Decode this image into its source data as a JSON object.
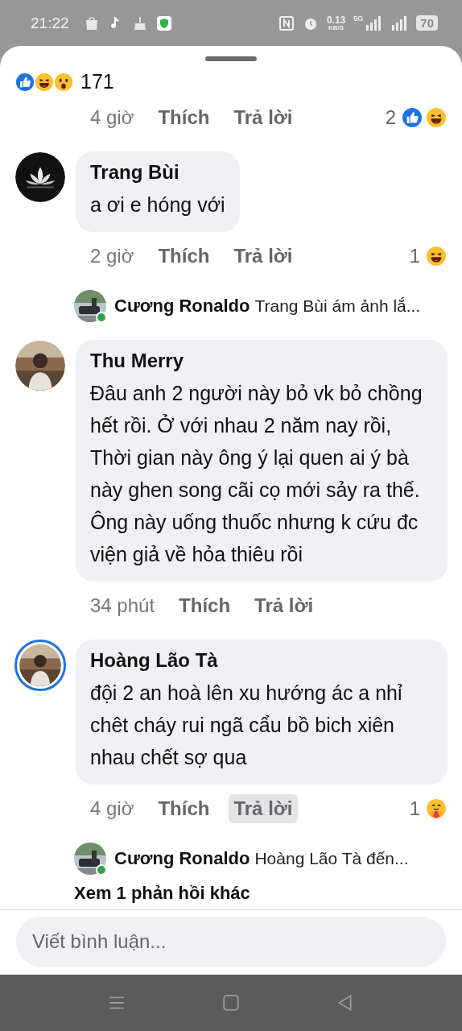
{
  "status_bar": {
    "time": "21:22",
    "speed_value": "0.13",
    "speed_unit": "KB/S",
    "network": "5G",
    "battery": "70"
  },
  "reactions_summary": {
    "reactions": [
      {
        "kind": "like"
      },
      {
        "kind": "haha"
      },
      {
        "kind": "wow"
      }
    ],
    "count": "171"
  },
  "comments": [
    {
      "kind": "actions",
      "time": "4 giờ",
      "like": "Thích",
      "reply": "Trả lời",
      "reply_pressed": false,
      "reaction_count": "2",
      "reactions": [
        {
          "kind": "like"
        },
        {
          "kind": "haha"
        }
      ]
    },
    {
      "kind": "comment",
      "story_ring": false,
      "author": "Trang Bùi",
      "text": "a ơi e hóng với",
      "time": "2 giờ",
      "like": "Thích",
      "reply": "Trả lời",
      "reply_pressed": false,
      "reaction_count": "1",
      "reactions": [
        {
          "kind": "haha"
        }
      ]
    },
    {
      "kind": "reply_preview",
      "online": true,
      "author": "Cương Ronaldo",
      "text": "Trang Bùi ám ảnh lắ..."
    },
    {
      "kind": "comment",
      "story_ring": false,
      "author": "Thu Merry",
      "text": "Đâu anh 2 người này bỏ vk bỏ chồng hết rồi. Ở với nhau 2 năm nay rồi, Thời gian này ông ý lại quen ai ý bà này ghen song cãi cọ mới sảy ra thế. Ông này uống thuốc nhưng k cứu đc viện giả về hỏa thiêu rồi",
      "time": "34 phút",
      "like": "Thích",
      "reply": "Trả lời",
      "reply_pressed": false
    },
    {
      "kind": "comment",
      "story_ring": true,
      "author": "Hoàng Lão Tà",
      "text": "đội 2 an hoà lên xu hướng ác a nhỉ chêt cháy rui ngã cẩu bồ bich xiên nhau chết sợ qua",
      "time": "4 giờ",
      "like": "Thích",
      "reply": "Trả lời",
      "reply_pressed": true,
      "reaction_count": "1",
      "reactions": [
        {
          "kind": "care"
        }
      ]
    },
    {
      "kind": "reply_preview",
      "online": true,
      "author": "Cương Ronaldo",
      "text": "Hoàng Lão Tà đến..."
    },
    {
      "kind": "more_replies",
      "text": "Xem 1 phản hồi khác"
    }
  ],
  "composer": {
    "placeholder": "Viết bình luận..."
  }
}
